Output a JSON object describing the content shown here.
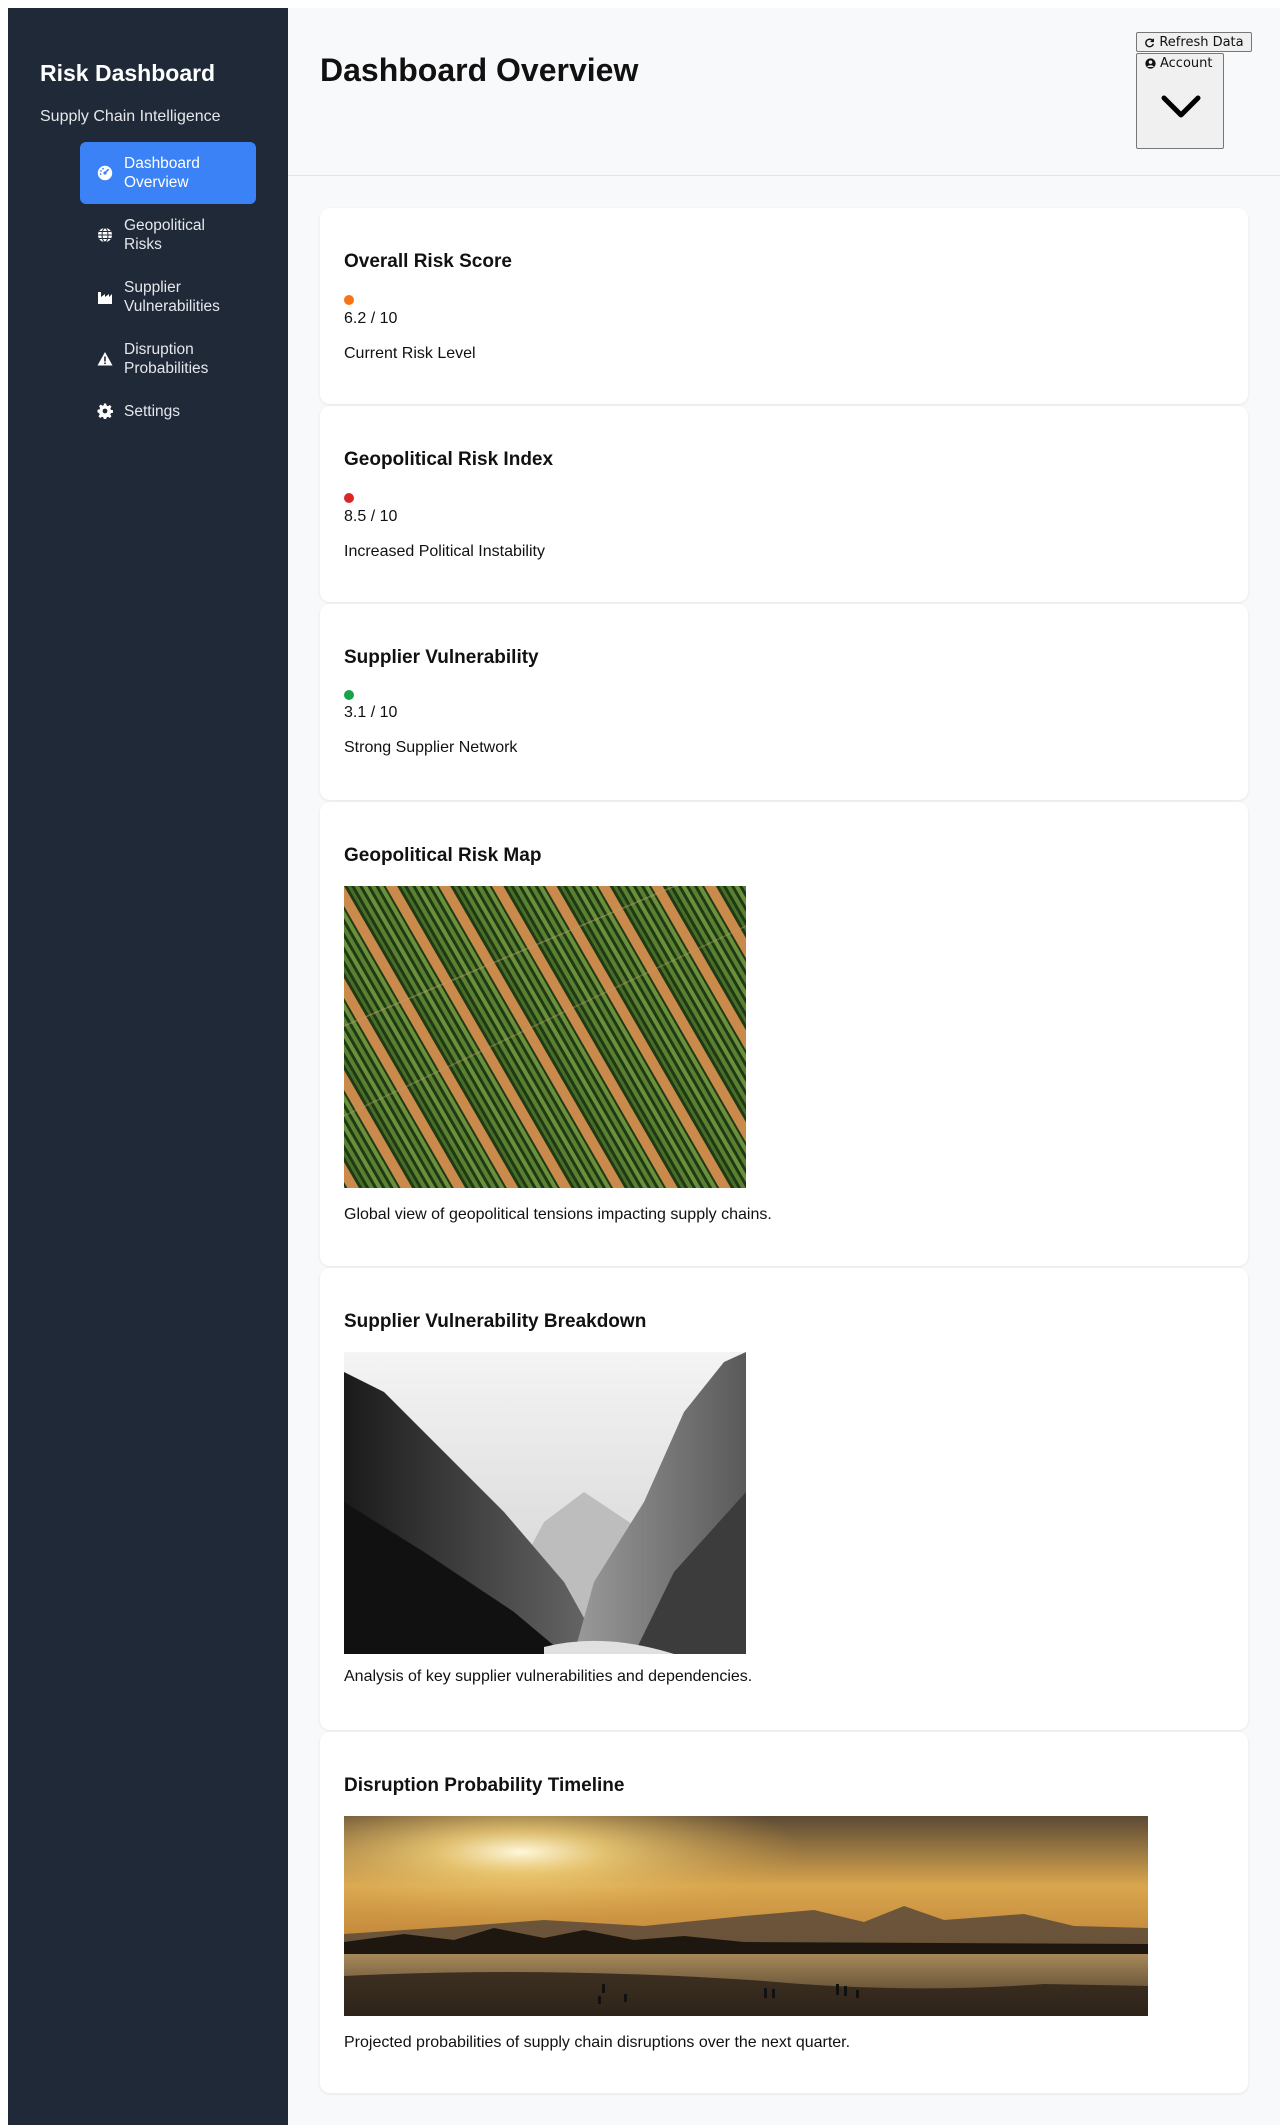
{
  "sidebar": {
    "title": "Risk Dashboard",
    "subtitle": "Supply Chain Intelligence",
    "items": [
      {
        "label": "Dashboard Overview",
        "icon": "dashboard-gauge-icon",
        "active": true
      },
      {
        "label": "Geopolitical Risks",
        "icon": "globe-icon",
        "active": false
      },
      {
        "label": "Supplier Vulnerabilities",
        "icon": "factory-icon",
        "active": false
      },
      {
        "label": "Disruption Probabilities",
        "icon": "warning-triangle-icon",
        "active": false
      },
      {
        "label": "Settings",
        "icon": "gear-icon",
        "active": false
      }
    ]
  },
  "header": {
    "title": "Dashboard Overview",
    "refresh_label": "Refresh Data",
    "account_label": "Account"
  },
  "cards": {
    "overall": {
      "title": "Overall Risk Score",
      "score": "6.2 / 10",
      "description": "Current Risk Level",
      "status_color": "#f97316"
    },
    "geo_index": {
      "title": "Geopolitical Risk Index",
      "score": "8.5 / 10",
      "description": "Increased Political Instability",
      "status_color": "#dc2626"
    },
    "supplier": {
      "title": "Supplier Vulnerability",
      "score": "3.1 / 10",
      "description": "Strong Supplier Network",
      "status_color": "#16a34a"
    },
    "geo_map": {
      "title": "Geopolitical Risk Map",
      "caption": "Global view of geopolitical tensions impacting supply chains."
    },
    "supplier_breakdown": {
      "title": "Supplier Vulnerability Breakdown",
      "caption": "Analysis of key supplier vulnerabilities and dependencies."
    },
    "timeline": {
      "title": "Disruption Probability Timeline",
      "caption": "Projected probabilities of supply chain disruptions over the next quarter."
    }
  },
  "colors": {
    "sidebar_bg": "#1f2937",
    "accent": "#3b82f6",
    "page_bg": "#f8f9fb"
  }
}
